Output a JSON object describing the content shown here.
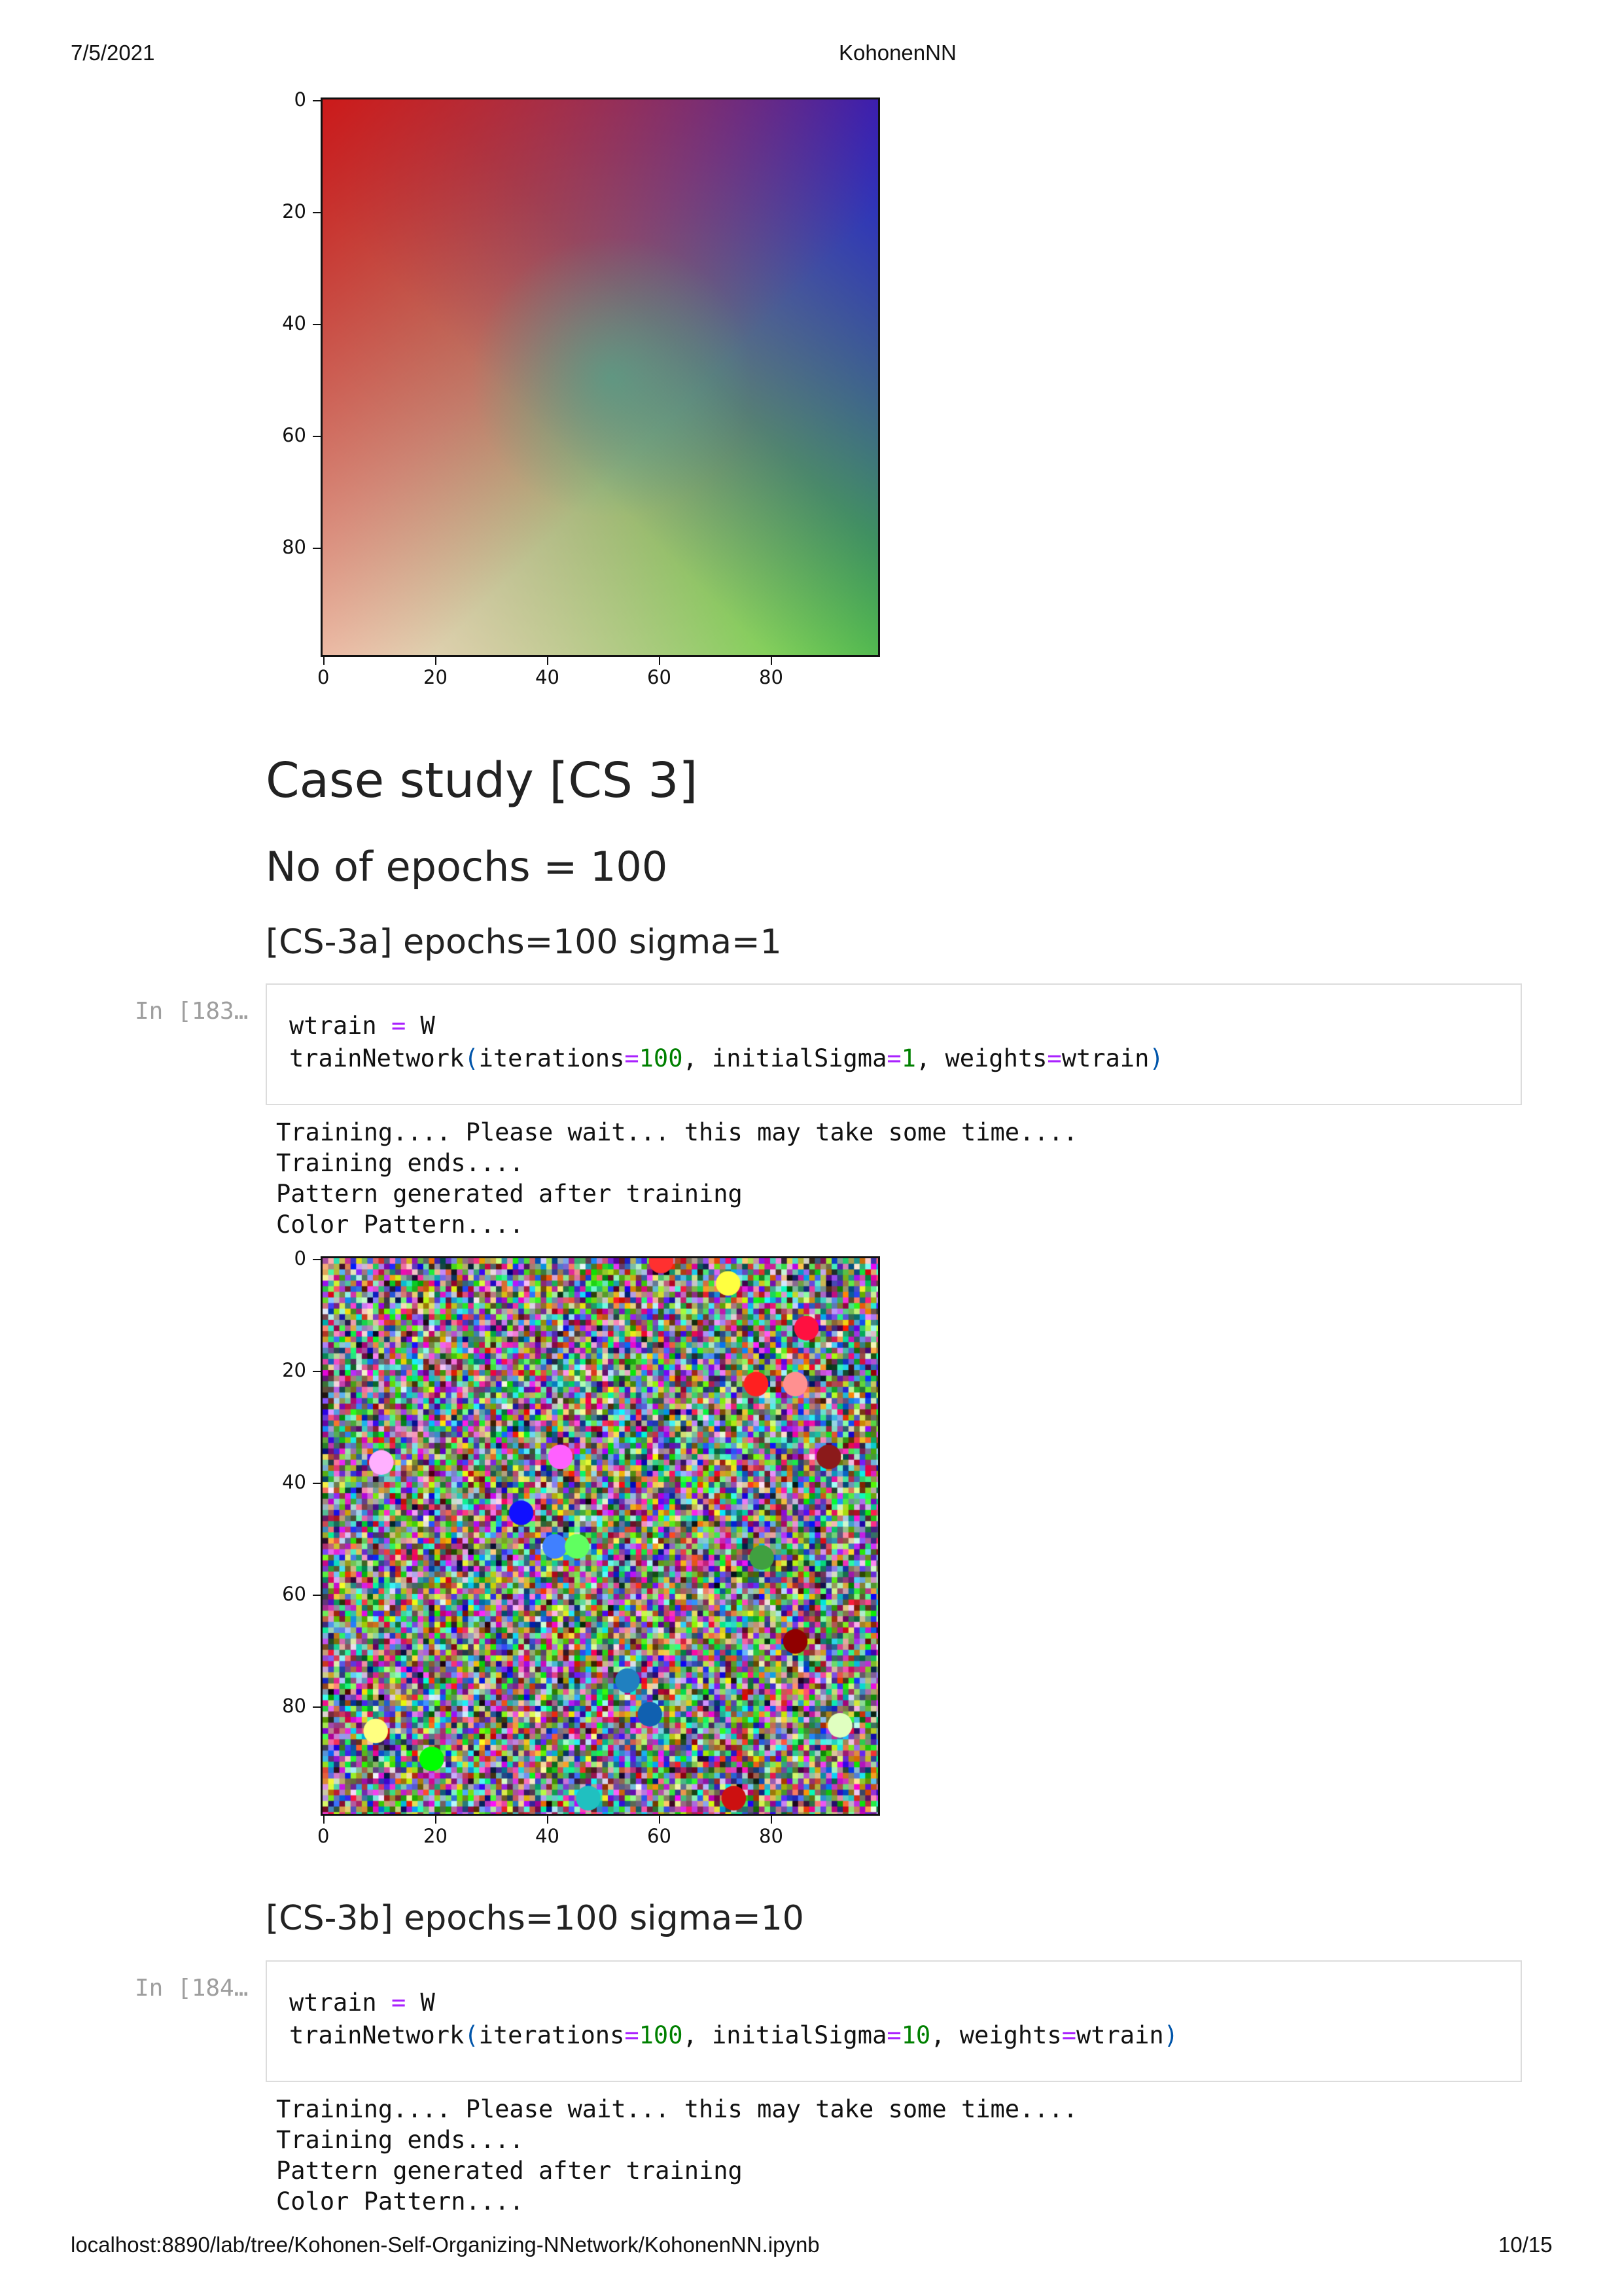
{
  "header": {
    "date": "7/5/2021",
    "title": "KohonenNN"
  },
  "footer": {
    "url": "localhost:8890/lab/tree/Kohonen-Self-Organizing-NNetwork/KohonenNN.ipynb",
    "page": "10/15"
  },
  "plot1": {
    "yticks": [
      "0",
      "20",
      "40",
      "60",
      "80"
    ],
    "xticks": [
      "0",
      "20",
      "40",
      "60",
      "80"
    ],
    "corner_colors": {
      "top_left": "#cc1a1a",
      "top_right": "#1f1fcc",
      "bottom_left": "#f2d9c0",
      "bottom_right": "#3fd81c",
      "center": "#4aa58a"
    }
  },
  "sections": {
    "h1": "Case study [CS 3]",
    "h2": "No of epochs = 100",
    "h3a": "[CS-3a] epochs=100 sigma=1",
    "h3b": "[CS-3b] epochs=100 sigma=10"
  },
  "cell1": {
    "prompt": "In [183…",
    "line1_var": "wtrain",
    "line1_op": "=",
    "line1_val": "W",
    "fn": "trainNetwork",
    "arg1": "iterations",
    "arg1_val": "100",
    "arg2": "initialSigma",
    "arg2_val": "1",
    "arg3": "weights",
    "arg3_val": "wtrain",
    "output": "Training.... Please wait... this may take some time....\nTraining ends....\nPattern generated after training\nColor Pattern...."
  },
  "plot2": {
    "yticks": [
      "0",
      "20",
      "40",
      "60",
      "80"
    ],
    "xticks": [
      "0",
      "20",
      "40",
      "60",
      "80"
    ]
  },
  "cell2": {
    "prompt": "In [184…",
    "line1_var": "wtrain",
    "line1_op": "=",
    "line1_val": "W",
    "fn": "trainNetwork",
    "arg1": "iterations",
    "arg1_val": "100",
    "arg2": "initialSigma",
    "arg2_val": "10",
    "arg3": "weights",
    "arg3_val": "wtrain",
    "output": "Training.... Please wait... this may take some time....\nTraining ends....\nPattern generated after training\nColor Pattern...."
  }
}
